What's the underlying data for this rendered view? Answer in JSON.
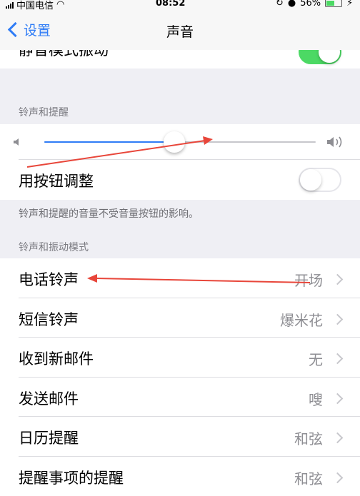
{
  "status_bar": {
    "carrier": "中国电信",
    "time": "08:52",
    "battery": "56%",
    "battery_level": 0.56
  },
  "nav": {
    "back_label": "设置",
    "title": "声音"
  },
  "silent_vibrate": {
    "label": "静音模式振动",
    "on": true
  },
  "ringer_section": {
    "header": "铃声和提醒",
    "volume_level": 0.48,
    "change_with_buttons": {
      "label": "用按钮调整",
      "on": false
    },
    "footer": "铃声和提醒的音量不受音量按钮的影响。"
  },
  "patterns_section": {
    "header": "铃声和振动模式",
    "items": [
      {
        "label": "电话铃声",
        "value": "开场"
      },
      {
        "label": "短信铃声",
        "value": "爆米花"
      },
      {
        "label": "收到新邮件",
        "value": "无"
      },
      {
        "label": "发送邮件",
        "value": "嗖"
      },
      {
        "label": "日历提醒",
        "value": "和弦"
      },
      {
        "label": "提醒事项的提醒",
        "value": "和弦"
      }
    ]
  },
  "colors": {
    "accent": "#2f7cf6",
    "toggle_on": "#4cd964",
    "annotation_arrow": "#e8463a"
  }
}
